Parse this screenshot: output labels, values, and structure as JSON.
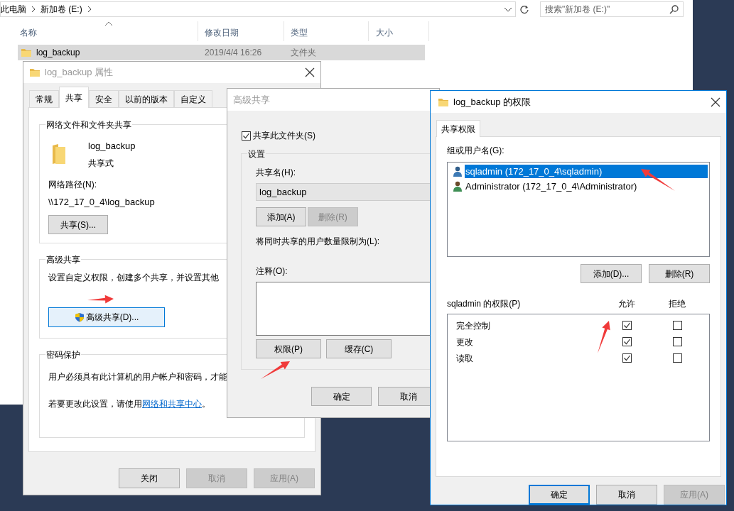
{
  "explorer": {
    "breadcrumb": [
      "此电脑",
      "新加卷 (E:)"
    ],
    "search_placeholder": "搜索\"新加卷 (E:)\"",
    "columns": [
      "名称",
      "修改日期",
      "类型",
      "大小"
    ],
    "rows": [
      {
        "name": "log_backup",
        "date": "2019/4/4 16:26",
        "type": "文件夹",
        "selected": true
      }
    ]
  },
  "properties": {
    "title": "log_backup 属性",
    "tabs": [
      {
        "label": "常规",
        "selected": false
      },
      {
        "label": "共享",
        "selected": true
      },
      {
        "label": "安全",
        "selected": false
      },
      {
        "label": "以前的版本",
        "selected": false
      },
      {
        "label": "自定义",
        "selected": false
      }
    ],
    "network_sharing": {
      "title": "网络文件和文件夹共享",
      "folder_name": "log_backup",
      "share_state": "共享式",
      "path_label": "网络路径(N):",
      "path": "\\\\172_17_0_4\\log_backup",
      "button": {
        "label": "共享(S)...",
        "disabled": false
      }
    },
    "advanced_sharing": {
      "title": "高级共享",
      "description": "设置自定义权限，创建多个共享，并设置其他",
      "button": {
        "label": "高级共享(D)...",
        "disabled": false
      }
    },
    "password_protection": {
      "title": "密码保护",
      "text": "用户必须具有此计算机的用户帐户和密码，才能",
      "change_text": "若要更改此设置，请使用",
      "link": "网络和共享中心",
      "change_text_end": "。"
    },
    "buttons": [
      {
        "label": "关闭",
        "disabled": false
      },
      {
        "label": "取消",
        "disabled": true
      },
      {
        "label": "应用(A)",
        "disabled": true
      }
    ]
  },
  "advanced_dialog": {
    "title": "高级共享",
    "share_checkbox": {
      "label": "共享此文件夹(S)",
      "checked": true
    },
    "settings_title": "设置",
    "share_name_label": "共享名(H):",
    "share_name": "log_backup",
    "name_buttons": [
      {
        "label": "添加(A)",
        "disabled": false
      },
      {
        "label": "删除(R)",
        "disabled": true
      }
    ],
    "limit_label": "将同时共享的用户数量限制为(L):",
    "comment_label": "注释(O):",
    "settings_buttons": [
      {
        "label": "权限(P)",
        "disabled": false
      },
      {
        "label": "缓存(C)",
        "disabled": false
      }
    ],
    "buttons": [
      {
        "label": "确定",
        "disabled": false
      },
      {
        "label": "取消",
        "disabled": false
      }
    ]
  },
  "permissions_dialog": {
    "title": "log_backup 的权限",
    "tabs": [
      {
        "label": "共享权限",
        "selected": true
      }
    ],
    "users_label": "组或用户名(G):",
    "users": [
      {
        "name": "sqladmin (172_17_0_4\\sqladmin)",
        "selected": true
      },
      {
        "name": "Administrator (172_17_0_4\\Administrator)",
        "selected": false
      }
    ],
    "user_buttons": [
      {
        "label": "添加(D)...",
        "disabled": false
      },
      {
        "label": "删除(R)",
        "disabled": false
      }
    ],
    "permissions_label": "sqladmin 的权限(P)",
    "allow_label": "允许",
    "deny_label": "拒绝",
    "permissions": [
      {
        "name": "完全控制",
        "allow": true,
        "deny": false
      },
      {
        "name": "更改",
        "allow": true,
        "deny": false
      },
      {
        "name": "读取",
        "allow": true,
        "deny": false
      }
    ],
    "buttons": [
      {
        "label": "确定",
        "disabled": false,
        "default": true
      },
      {
        "label": "取消",
        "disabled": false,
        "default": false
      },
      {
        "label": "应用(A)",
        "disabled": true,
        "default": false
      }
    ]
  }
}
